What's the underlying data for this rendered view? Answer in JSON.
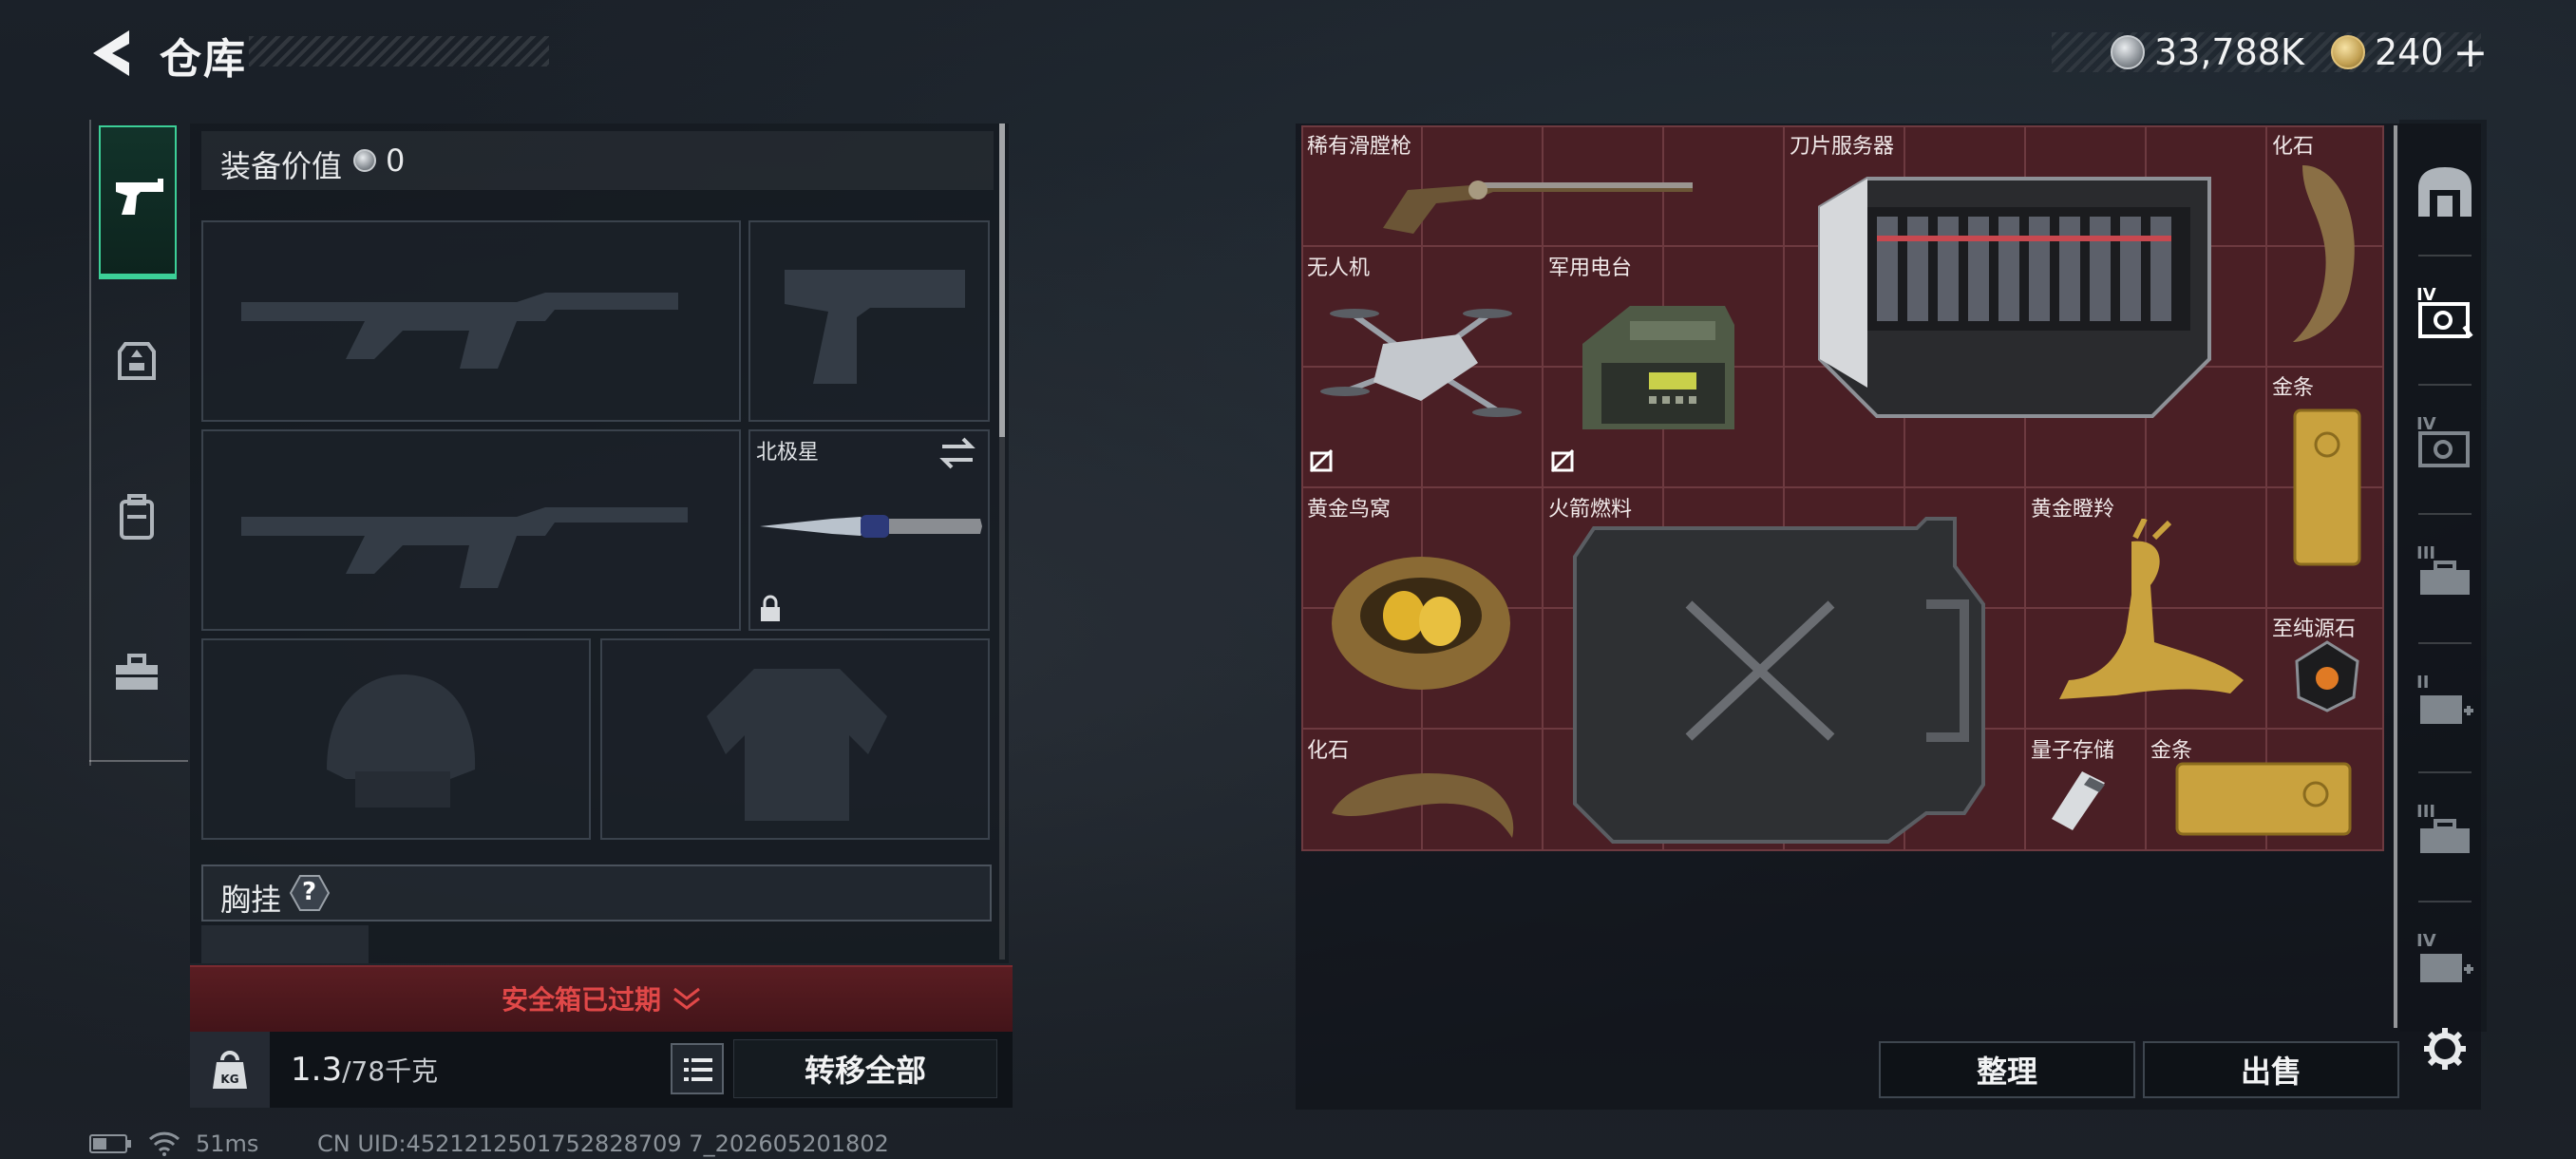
{
  "header": {
    "title": "仓库",
    "currency_silver": "33,788K",
    "currency_gold": "240",
    "add_label": "+"
  },
  "left_rail": {
    "tabs": [
      "weapon-icon",
      "armor-icon",
      "backpack-icon",
      "toolbox-icon"
    ]
  },
  "loadout": {
    "equip_value_label": "装备价值",
    "equip_value": "0",
    "melee_name": "北极星",
    "chest_label": "胸挂",
    "chest_help": "?",
    "safebox_text": "安全箱已过期",
    "weight_current": "1.3",
    "weight_capacity": "/78千克",
    "transfer_all": "转移全部"
  },
  "stash": {
    "items": [
      {
        "name": "稀有滑膛枪"
      },
      {
        "name": "刀片服务器"
      },
      {
        "name": "化石"
      },
      {
        "name": "无人机",
        "no_sell": true
      },
      {
        "name": "军用电台",
        "no_sell": true
      },
      {
        "name": "金条"
      },
      {
        "name": "黄金鸟窝"
      },
      {
        "name": "火箭燃料"
      },
      {
        "name": "黄金瞪羚"
      },
      {
        "name": "至纯源石"
      },
      {
        "name": "化石"
      },
      {
        "name": "量子存储"
      },
      {
        "name": "金条"
      }
    ],
    "sort_label": "整理",
    "sell_label": "出售"
  },
  "right_rail": {
    "tiers": [
      "IV",
      "IV",
      "III",
      "II",
      "III",
      "IV"
    ]
  },
  "status": {
    "ping": "51ms",
    "uid": "CN UID:4521212501752828709 7_202605201802"
  },
  "colors": {
    "accent_green": "#3ccf97",
    "stash_bg": "#4a1f25",
    "warning_red": "#e04848"
  }
}
